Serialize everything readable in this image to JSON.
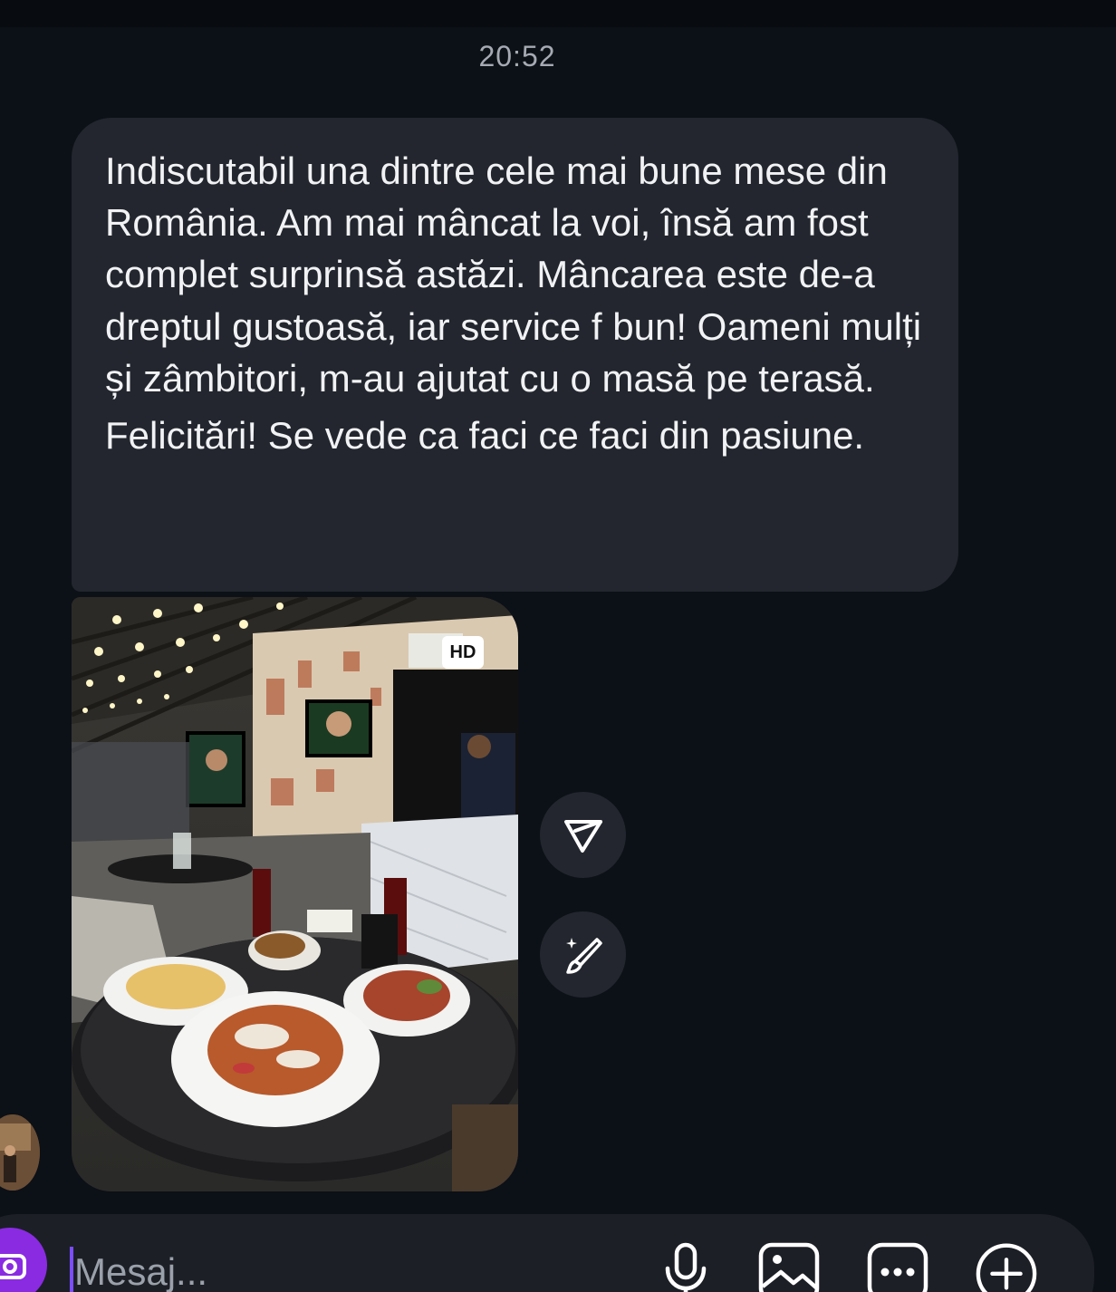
{
  "chat": {
    "timestamp": "20:52",
    "message": {
      "paragraphs": [
        "Indiscutabil una dintre cele mai bune mese din România. Am mai mâncat la voi, însă am fost complet surprinsă astăzi. Mâncarea este de-a dreptul gustoasă, iar service f bun! Oameni mulți și zâmbitori, m-au ajutat cu o masă pe terasă.",
        "Felicitări! Se vede ca faci ce faci din pasiune."
      ]
    },
    "photo": {
      "badge": "HD"
    }
  },
  "actions": {
    "share_icon": "paper-plane-icon",
    "edit_icon": "magic-brush-icon"
  },
  "composer": {
    "placeholder": "Mesaj...",
    "icons": [
      "camera-icon",
      "microphone-icon",
      "gallery-icon",
      "more-icon",
      "plus-icon"
    ]
  },
  "colors": {
    "background": "#0c1017",
    "bubble": "#23262e",
    "accent": "#8a2be2",
    "caret": "#7b4dff"
  }
}
